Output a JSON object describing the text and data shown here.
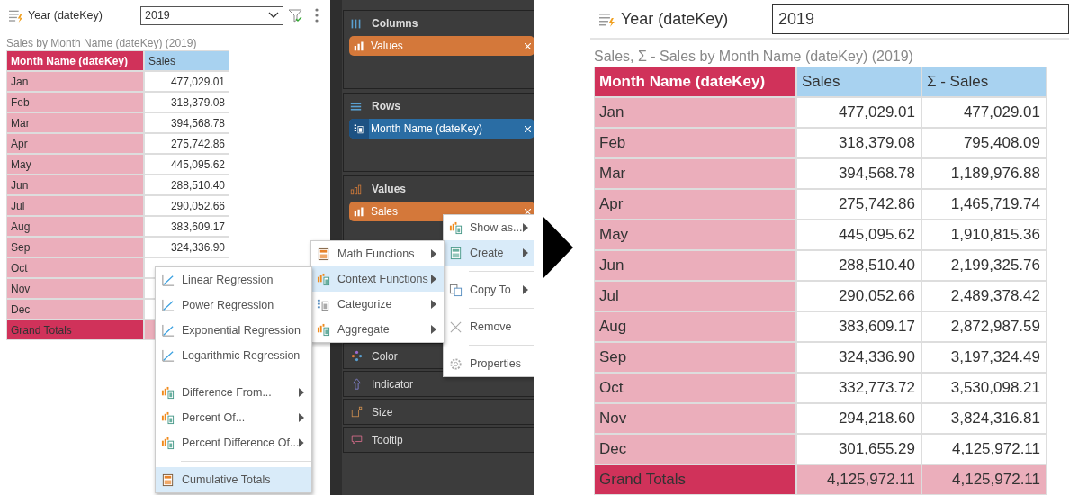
{
  "left_view": {
    "filter": {
      "label": "Year (dateKey)",
      "value": "2019"
    },
    "table_title": "Sales by Month Name (dateKey) (2019)",
    "columns": [
      "Month Name (dateKey)",
      "Sales"
    ],
    "rows": [
      {
        "label": "Jan",
        "values": [
          "477,029.01"
        ]
      },
      {
        "label": "Feb",
        "values": [
          "318,379.08"
        ]
      },
      {
        "label": "Mar",
        "values": [
          "394,568.78"
        ]
      },
      {
        "label": "Apr",
        "values": [
          "275,742.86"
        ]
      },
      {
        "label": "May",
        "values": [
          "445,095.62"
        ]
      },
      {
        "label": "Jun",
        "values": [
          "288,510.40"
        ]
      },
      {
        "label": "Jul",
        "values": [
          "290,052.66"
        ]
      },
      {
        "label": "Aug",
        "values": [
          "383,609.17"
        ]
      },
      {
        "label": "Sep",
        "values": [
          "324,336.90"
        ]
      },
      {
        "label": "Oct",
        "values": []
      },
      {
        "label": "Nov",
        "values": []
      },
      {
        "label": "Dec",
        "values": []
      }
    ],
    "grand_total": {
      "label": "Grand Totals"
    }
  },
  "fields_panel": {
    "sections": [
      {
        "title": "Columns",
        "kind": "columns",
        "chips": [
          {
            "label": "Values",
            "kind": "measure"
          }
        ]
      },
      {
        "title": "Rows",
        "kind": "rows",
        "chips": [
          {
            "label": "Month Name (dateKey)",
            "kind": "dimension"
          }
        ]
      },
      {
        "title": "Values",
        "kind": "values",
        "chips": [
          {
            "label": "Sales",
            "kind": "measure"
          }
        ]
      }
    ],
    "wells": [
      {
        "label": "Color",
        "kind": "color"
      },
      {
        "label": "Indicator",
        "kind": "indicator"
      },
      {
        "label": "Size",
        "kind": "size"
      },
      {
        "label": "Tooltip",
        "kind": "tooltip"
      }
    ]
  },
  "field_menu": {
    "groups": [
      [
        {
          "label": "Show as...",
          "kind": "show-as",
          "submenu": true,
          "selected": false
        },
        {
          "label": "Create",
          "kind": "calc-teal",
          "submenu": true,
          "selected": true
        }
      ],
      [
        {
          "label": "Copy To",
          "kind": "copy",
          "submenu": true,
          "selected": false
        }
      ],
      [
        {
          "label": "Remove",
          "kind": "close",
          "submenu": false,
          "selected": false
        }
      ],
      [
        {
          "label": "Properties",
          "kind": "gear",
          "submenu": false,
          "selected": false
        }
      ]
    ]
  },
  "create_menu": {
    "groups": [
      [
        {
          "label": "Math Functions",
          "kind": "calc",
          "submenu": true,
          "selected": false
        },
        {
          "label": "Context Functions",
          "kind": "bars-calc",
          "submenu": true,
          "selected": true
        },
        {
          "label": "Categorize",
          "kind": "list-calc",
          "submenu": true,
          "selected": false
        },
        {
          "label": "Aggregate",
          "kind": "bars-calc",
          "submenu": true,
          "selected": false
        }
      ]
    ]
  },
  "context_menu": {
    "groups": [
      [
        {
          "label": "Linear Regression",
          "kind": "trend",
          "submenu": false,
          "selected": false
        },
        {
          "label": "Power Regression",
          "kind": "trend",
          "submenu": false,
          "selected": false
        },
        {
          "label": "Exponential Regression",
          "kind": "trend",
          "submenu": false,
          "selected": false
        },
        {
          "label": "Logarithmic Regression",
          "kind": "trend",
          "submenu": false,
          "selected": false
        }
      ],
      [
        {
          "label": "Difference From...",
          "kind": "bars-calc",
          "submenu": true,
          "selected": false
        },
        {
          "label": "Percent Of...",
          "kind": "bars-calc",
          "submenu": true,
          "selected": false
        },
        {
          "label": "Percent Difference Of...",
          "kind": "bars-calc",
          "submenu": true,
          "selected": false
        }
      ],
      [
        {
          "label": "Cumulative Totals",
          "kind": "calc",
          "submenu": false,
          "selected": true
        }
      ]
    ]
  },
  "result_view": {
    "filter": {
      "label": "Year (dateKey)",
      "value": "2019"
    },
    "table_title": "Sales, Σ - Sales by Month Name (dateKey) (2019)",
    "columns": [
      "Month Name (dateKey)",
      "Sales",
      "Σ - Sales"
    ],
    "rows": [
      {
        "label": "Jan",
        "values": [
          "477,029.01",
          "477,029.01"
        ]
      },
      {
        "label": "Feb",
        "values": [
          "318,379.08",
          "795,408.09"
        ]
      },
      {
        "label": "Mar",
        "values": [
          "394,568.78",
          "1,189,976.88"
        ]
      },
      {
        "label": "Apr",
        "values": [
          "275,742.86",
          "1,465,719.74"
        ]
      },
      {
        "label": "May",
        "values": [
          "445,095.62",
          "1,910,815.36"
        ]
      },
      {
        "label": "Jun",
        "values": [
          "288,510.40",
          "2,199,325.76"
        ]
      },
      {
        "label": "Jul",
        "values": [
          "290,052.66",
          "2,489,378.42"
        ]
      },
      {
        "label": "Aug",
        "values": [
          "383,609.17",
          "2,872,987.59"
        ]
      },
      {
        "label": "Sep",
        "values": [
          "324,336.90",
          "3,197,324.49"
        ]
      },
      {
        "label": "Oct",
        "values": [
          "332,773.72",
          "3,530,098.21"
        ]
      },
      {
        "label": "Nov",
        "values": [
          "294,218.60",
          "3,824,316.81"
        ]
      },
      {
        "label": "Dec",
        "values": [
          "301,655.29",
          "4,125,972.11"
        ]
      }
    ],
    "grand_total": {
      "label": "Grand Totals",
      "values": [
        "4,125,972.11",
        "4,125,972.11"
      ]
    }
  }
}
